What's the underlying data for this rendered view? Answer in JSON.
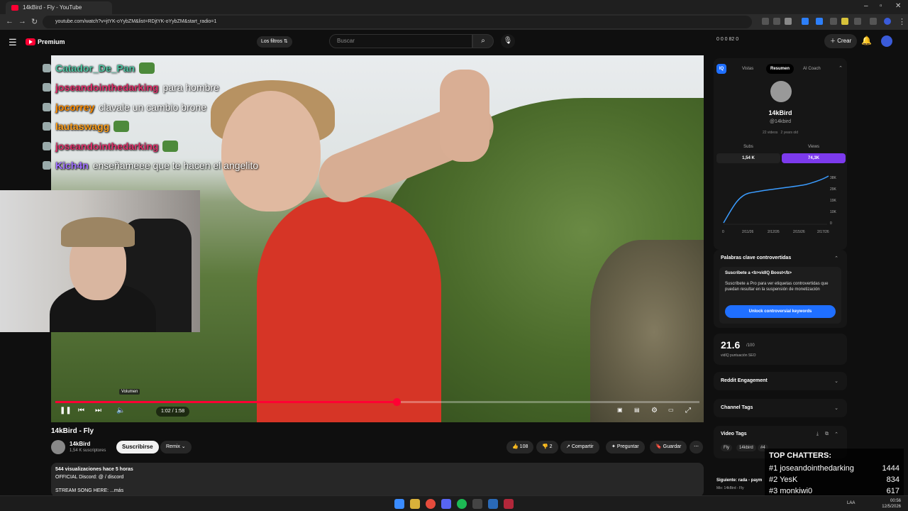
{
  "browser": {
    "tab_title": "14kBird - Fly - YouTube",
    "url": "youtube.com/watch?v=jtYK-oYybZM&list=RDjtYK-oYybZM&start_radio=1"
  },
  "header": {
    "logo_text": "Premium",
    "filters_label": "Los filtros",
    "search_placeholder": "Buscar",
    "counters": "0  0  0  82  0",
    "create_label": "Crear"
  },
  "chat": [
    {
      "user": "Catador_De_Pan",
      "msg": "",
      "color": "#4fc3a1"
    },
    {
      "user": "joseandointhedarking",
      "msg": "para hombre",
      "color": "#e0306a"
    },
    {
      "user": "jocorrey",
      "msg": "clavale un cambio brone",
      "color": "#ff8c00"
    },
    {
      "user": "lautaswagg",
      "msg": "",
      "color": "#ff9f1a"
    },
    {
      "user": "joseandointhedarking",
      "msg": "",
      "color": "#e0306a"
    },
    {
      "user": "Kich4n",
      "msg": "enseñameee que te hacen el angelito",
      "color": "#a070ff"
    }
  ],
  "player": {
    "time": "1:02 / 1:58",
    "tooltip": "Volumen",
    "progress": 0.53
  },
  "video": {
    "title": "14kBird - Fly",
    "channel": "14kBird",
    "subs": "1,54 K suscriptores",
    "subscribe_label": "Suscribirse",
    "remix_label": "Remix",
    "likes": "108",
    "dislikes": "2",
    "share_label": "Compartir",
    "ask_label": "Preguntar",
    "save_label": "Guardar",
    "views_line": "544 visualizaciones  hace 5 horas",
    "discord_line": "OFFICIAL Discord: @ / discord",
    "song_line": "STREAM SONG HERE: ...más"
  },
  "vidiq": {
    "tabs": [
      "Vistas",
      "Resumen",
      "AI Coach"
    ],
    "name": "14kBird",
    "handle": "@14kbird",
    "meta": [
      "22 videos",
      "2 years old"
    ],
    "subs_label": "Subs",
    "subs_value": "1,54 K",
    "views_label": "Views",
    "views_value": "74,3K",
    "y_ticks": [
      "38K",
      "29K",
      "19K",
      "10K",
      "0"
    ],
    "x_ticks": [
      "0",
      "2/11/26",
      "2/12/26",
      "2/15/26",
      "2/17/26"
    ],
    "keywords_title": "Palabras clave controvertidas",
    "boost_title": "Suscríbete a <b>vidIQ Boost</b>",
    "boost_text": "Suscríbete a Pro para ver etiquetas controvertidas que puedan resultar en la suspensión de monetización",
    "unlock_label": "Unlock controversial keywords",
    "seo_score": "21.6",
    "seo_max": "/100",
    "seo_label": "vidIQ puntuación SEO",
    "reddit_label": "Reddit Engagement",
    "channel_tags_label": "Channel Tags",
    "video_tags_label": "Video Tags",
    "tags": [
      "Fly",
      "14kbird",
      "#4"
    ],
    "next_label": "Siguiente: rada - paym",
    "next_sub": "Mix: 14kBird - Fly"
  },
  "chatters": {
    "title": "TOP CHATTERS:",
    "rows": [
      {
        "rank": "#1",
        "name": "joseandointhedarking",
        "count": "1444"
      },
      {
        "rank": "#2",
        "name": "YesK",
        "count": "834"
      },
      {
        "rank": "#3",
        "name": "monkiwi0",
        "count": "617"
      }
    ]
  },
  "taskbar": {
    "lang": "LAA",
    "time": "00:56",
    "date": "12/5/2026"
  },
  "colors": {
    "accent_red": "#ff0033",
    "vidiq_purple": "#7c3aed",
    "vidiq_blue": "#1f6fff"
  }
}
